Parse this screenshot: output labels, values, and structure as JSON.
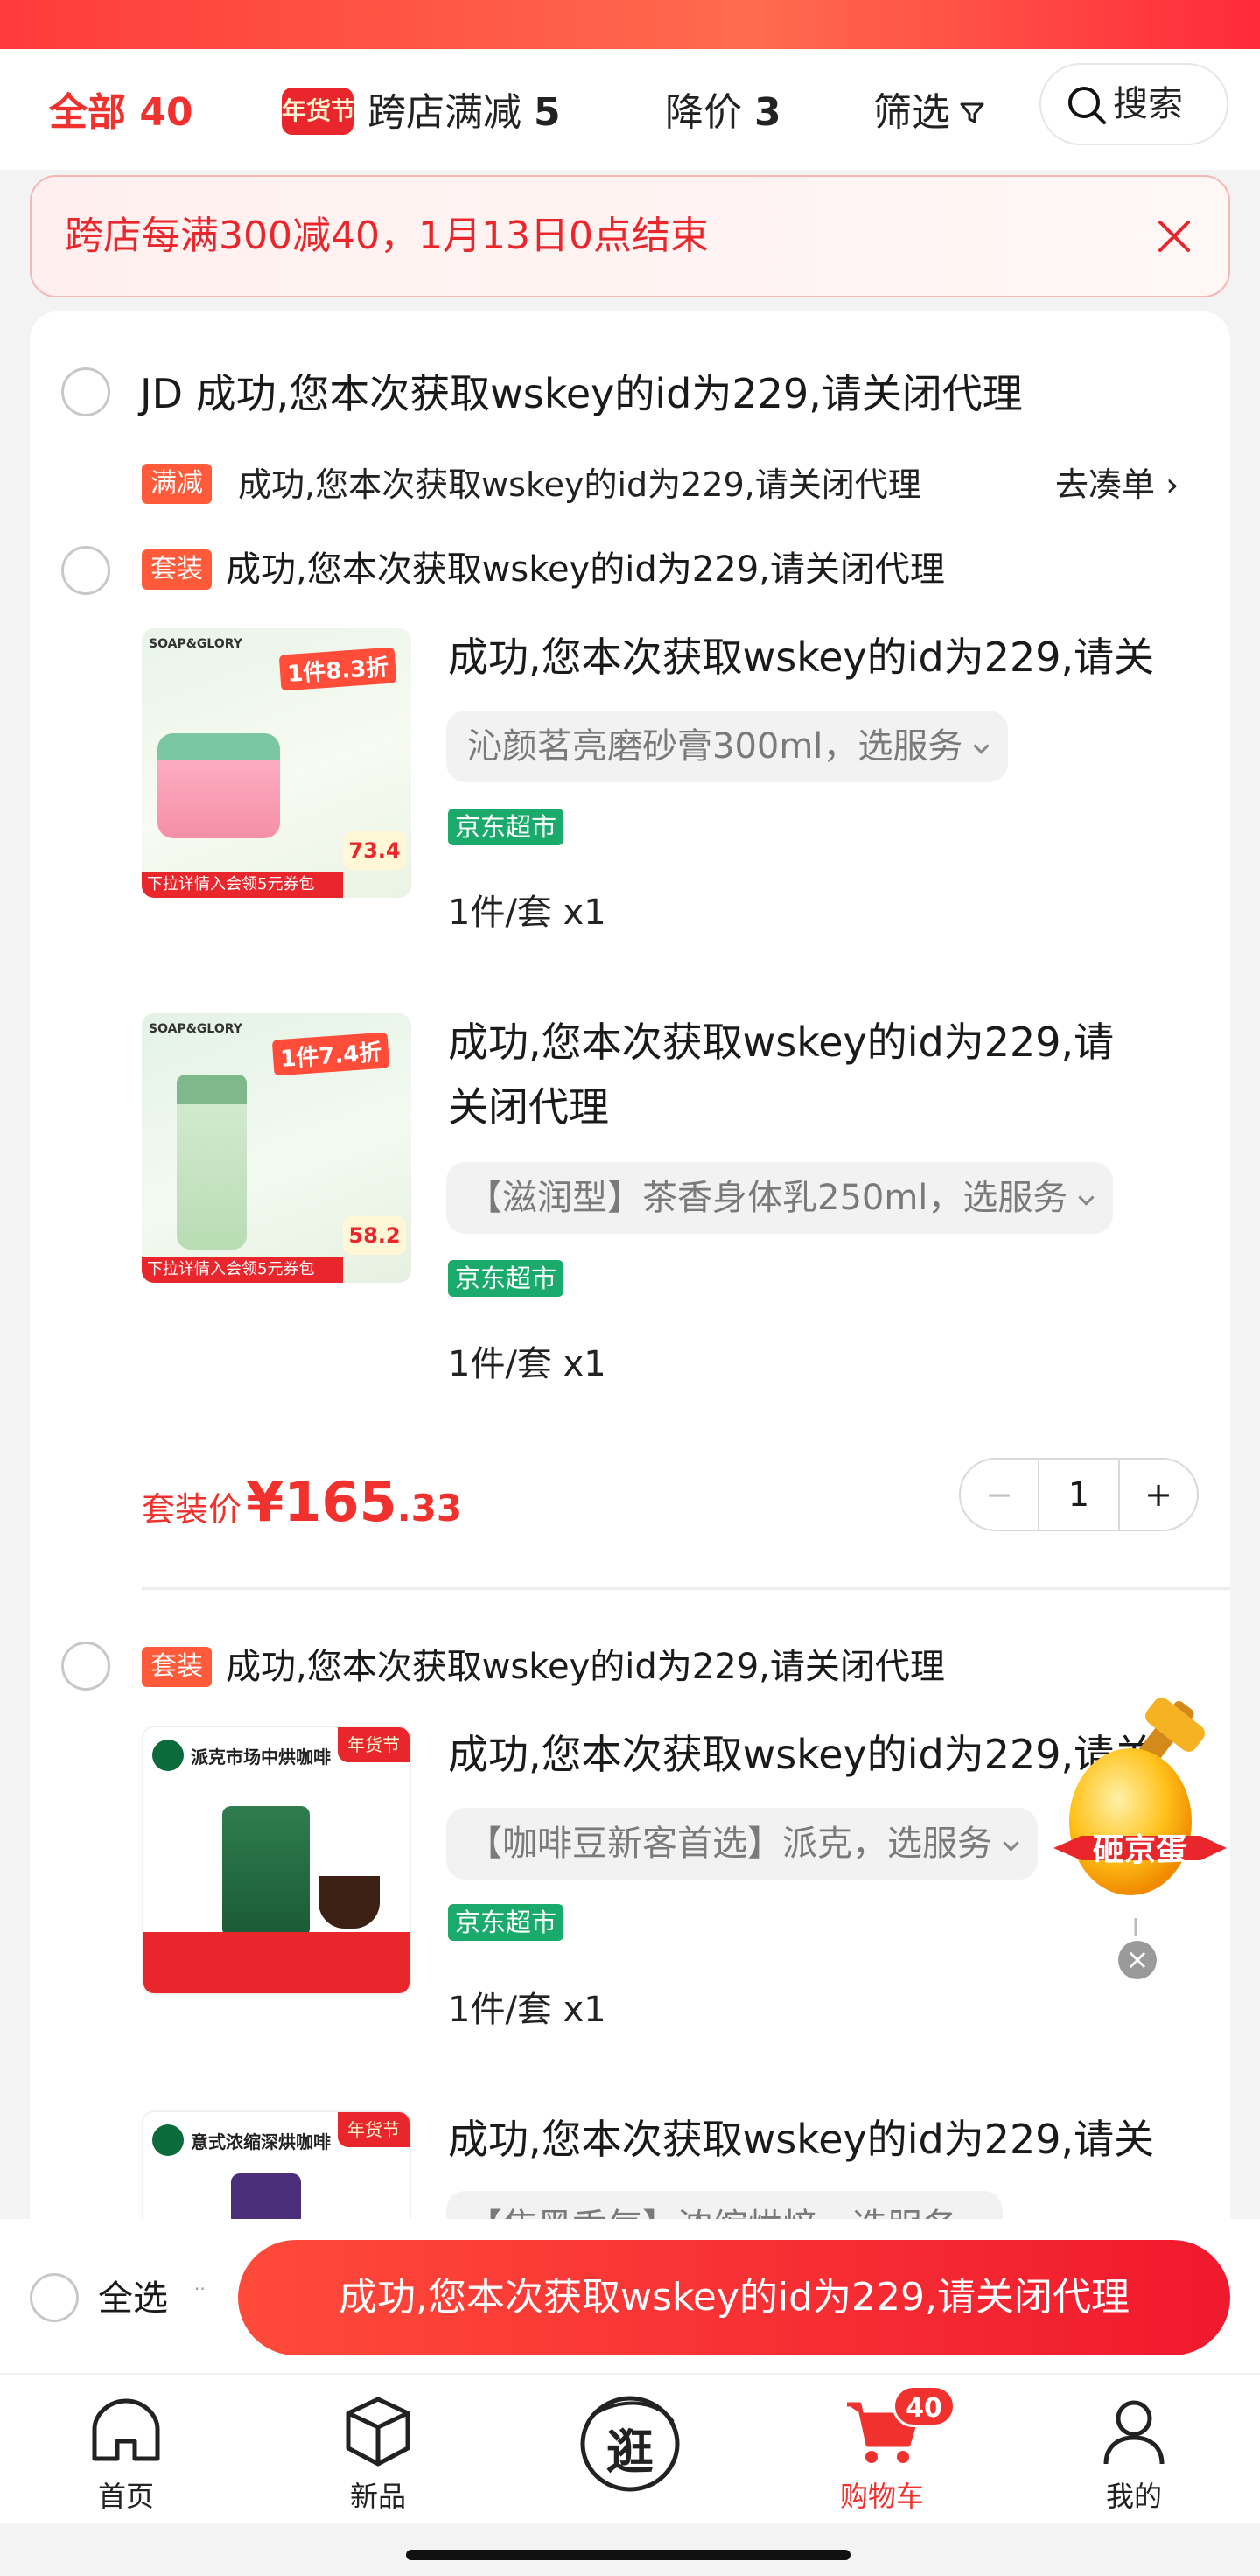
{
  "tabs": {
    "all_label": "全部",
    "all_count": "40",
    "cross_badge": "年货节",
    "cross_label": "跨店满减",
    "cross_count": "5",
    "drop_label": "降价",
    "drop_count": "3",
    "filter_label": "筛选",
    "search_label": "搜索"
  },
  "banner": {
    "text": "跨店每满300减40，1月13日0点结束"
  },
  "store": {
    "name": "JD 成功,您本次获取wskey的id为229,请关闭代理",
    "promo_tag": "满减",
    "promo_text": "成功,您本次获取wskey的id为229,请关闭代理",
    "promo_link": "去凑单"
  },
  "bundle1": {
    "tag": "套装",
    "title": "成功,您本次获取wskey的id为229,请关闭代理",
    "items": [
      {
        "title": "成功,您本次获取wskey的id为229,请关",
        "spec": "沁颜茗亮磨砂膏300ml，选服务",
        "store_tag": "京东超市",
        "qty": "1件/套  x1",
        "img_brand": "SOAP&GLORY",
        "img_deal": "1件8.3折",
        "img_price": "73.4",
        "img_footer": "下拉详情入会领5元券包"
      },
      {
        "title": "成功,您本次获取wskey的id为229,请关闭代理",
        "spec": "【滋润型】茶香身体乳250ml，选服务",
        "store_tag": "京东超市",
        "qty": "1件/套  x1",
        "img_brand": "SOAP&GLORY",
        "img_deal": "1件7.4折",
        "img_price": "58.2",
        "img_footer": "下拉详情入会领5元券包"
      }
    ],
    "price_label": "套装价",
    "price_int": "¥165",
    "price_dec": ".33",
    "quantity": "1"
  },
  "bundle2": {
    "tag": "套装",
    "title": "成功,您本次获取wskey的id为229,请关闭代理",
    "items": [
      {
        "title": "成功,您本次获取wskey的id为229,请关",
        "spec": "【咖啡豆新客首选】派克，选服务",
        "store_tag": "京东超市",
        "qty": "1件/套  x1",
        "img_head": "派克市场中烘咖啡",
        "img_badge": "年货节"
      },
      {
        "title": "成功,您本次获取wskey的id为229,请关",
        "spec": "【焦黑香气】浓缩烘焙，选服务",
        "img_head": "意式浓缩深烘咖啡",
        "img_badge": "年货节"
      }
    ]
  },
  "egg": {
    "label": "砸京蛋"
  },
  "bottom": {
    "select_all": "全选",
    "checkout": "成功,您本次获取wskey的id为229,请关闭代理"
  },
  "nav": {
    "home": "首页",
    "new": "新品",
    "browse": "逛",
    "cart": "购物车",
    "cart_badge": "40",
    "me": "我的"
  },
  "colors": {
    "accent": "#f0312d",
    "jd_green": "#1aaa6c",
    "promo_orange": "#ff5a3a"
  }
}
